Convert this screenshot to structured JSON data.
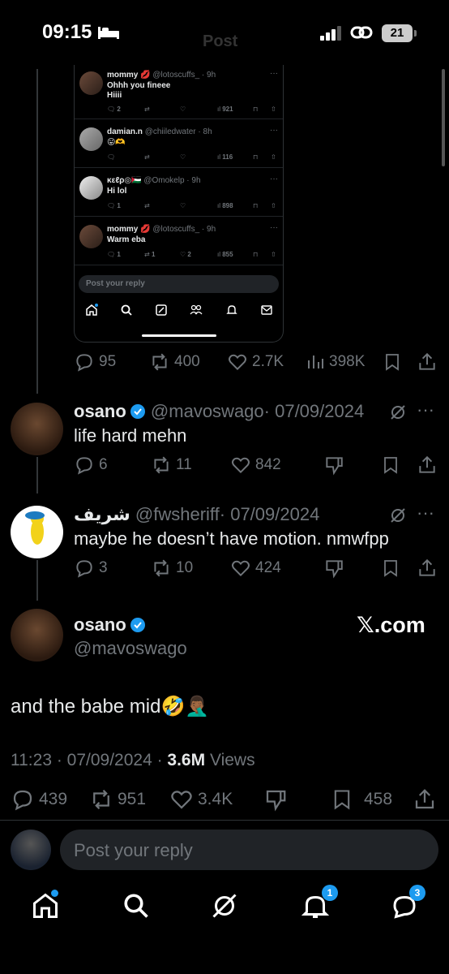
{
  "status": {
    "time": "09:15",
    "battery": "21",
    "faded_title": "Post"
  },
  "embedded": {
    "replies": [
      {
        "name": "mommy 💋",
        "handle": "@lotoscuffs_ · 9h",
        "lines": [
          "Ohhh you fineee",
          "Hiiii"
        ],
        "reply": "2",
        "repost": "",
        "like": "",
        "views": "921"
      },
      {
        "name": "damian.n",
        "handle": "@chiiledwater · 8h",
        "lines": [
          "😛🫶"
        ],
        "reply": "",
        "repost": "",
        "like": "",
        "views": "116"
      },
      {
        "name": "κεℓρ◎🇵🇸",
        "handle": "@Omokelp · 9h",
        "lines": [
          "Hi lol"
        ],
        "reply": "1",
        "repost": "",
        "like": "",
        "views": "898"
      },
      {
        "name": "mommy 💋",
        "handle": "@lotoscuffs_ · 9h",
        "lines": [
          "Warm eba"
        ],
        "reply": "1",
        "repost": "1",
        "like": "2",
        "views": "855"
      }
    ],
    "reply_placeholder": "Post your reply"
  },
  "quoted_post_actions": {
    "replies": "95",
    "reposts": "400",
    "likes": "2.7K",
    "views": "398K"
  },
  "reply1": {
    "name": "osano",
    "handle": "@mavoswago",
    "date": "· 07/09/2024",
    "text": "life hard mehn",
    "replies": "6",
    "reposts": "11",
    "likes": "842"
  },
  "reply2": {
    "name": "شريف",
    "handle": "@fwsheriff",
    "date": "· 07/09/2024",
    "text": "maybe he doesn’t have motion. nmwfpp",
    "replies": "3",
    "reposts": "10",
    "likes": "424"
  },
  "main_post": {
    "name": "osano",
    "handle": "@mavoswago",
    "source": "𝕏.com",
    "text": "and the babe mid🤣🤦🏾‍♂️",
    "time": "11:23 · 07/09/2024 · ",
    "views_count": "3.6M",
    "views_label": " Views",
    "replies": "439",
    "reposts": "951",
    "likes": "3.4K",
    "bookmarks": "458"
  },
  "reply_input": {
    "placeholder": "Post your reply"
  },
  "tabbar": {
    "notifications_badge": "1",
    "messages_badge": "3"
  },
  "colors": {
    "accent": "#1d9bf0",
    "muted": "#71767b",
    "background": "#000000"
  }
}
